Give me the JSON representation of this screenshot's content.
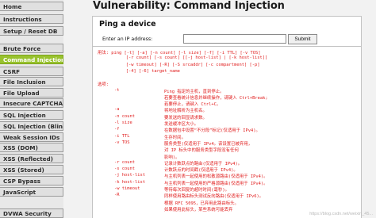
{
  "sidebar": {
    "items": [
      {
        "label": "Home",
        "active": false
      },
      {
        "label": "Instructions",
        "active": false
      },
      {
        "label": "Setup / Reset DB",
        "active": false
      },
      {
        "label": "Brute Force",
        "active": false
      },
      {
        "label": "Command Injection",
        "active": true
      },
      {
        "label": "CSRF",
        "active": false
      },
      {
        "label": "File Inclusion",
        "active": false
      },
      {
        "label": "File Upload",
        "active": false
      },
      {
        "label": "Insecure CAPTCHA",
        "active": false
      },
      {
        "label": "SQL Injection",
        "active": false
      },
      {
        "label": "SQL Injection (Blind)",
        "active": false
      },
      {
        "label": "Weak Session IDs",
        "active": false
      },
      {
        "label": "XSS (DOM)",
        "active": false
      },
      {
        "label": "XSS (Reflected)",
        "active": false
      },
      {
        "label": "XSS (Stored)",
        "active": false
      },
      {
        "label": "CSP Bypass",
        "active": false
      },
      {
        "label": "JavaScript",
        "active": false
      },
      {
        "label": "DVWA Security",
        "active": false
      }
    ],
    "accent_color": "#98c22e"
  },
  "main": {
    "title": "Vulnerability: Command Injection",
    "box_title": "Ping a device",
    "ip_label": "Enter an IP address:",
    "ip_value": "",
    "submit_label": "Submit"
  },
  "output": {
    "usage_lines": [
      "用法: ping [-t] [-a] [-n count] [-l size] [-f] [-i TTL] [-v TOS]",
      "           [-r count] [-s count] [[-j host-list] | [-k host-list]]",
      "           [-w timeout] [-R] [-S srcaddr] [-c compartment] [-p]",
      "           [-4] [-6] target_name"
    ],
    "options_heading": "选项:",
    "options": [
      {
        "flag": "-t",
        "text": "Ping 指定的主机，直到停止。"
      },
      {
        "flag": "",
        "text": "若要查看统计信息并继续操作，请键入 Ctrl+Break;"
      },
      {
        "flag": "",
        "text": "若要停止，请键入 Ctrl+C。"
      },
      {
        "flag": "-a",
        "text": "将地址解析为主机名。"
      },
      {
        "flag": "-n count",
        "text": "要发送的回显请求数。"
      },
      {
        "flag": "-l size",
        "text": "发送缓冲区大小。"
      },
      {
        "flag": "-f",
        "text": "在数据包中设置“不分段”标记(仅适用于 IPv4)。"
      },
      {
        "flag": "-i TTL",
        "text": "生存时间。"
      },
      {
        "flag": "-v TOS",
        "text": "服务类型(仅适用于 IPv4。该设置已被弃用，"
      },
      {
        "flag": "",
        "text": "对 IP 标头中的服务类型字段没有任何"
      },
      {
        "flag": "",
        "text": "影响)。"
      },
      {
        "flag": "-r count",
        "text": "记录计数跃点的路由(仅适用于 IPv4)。"
      },
      {
        "flag": "-s count",
        "text": "计数跃点的时间戳(仅适用于 IPv4)。"
      },
      {
        "flag": "-j host-list",
        "text": "与主机列表一起使用的松散源路由(仅适用于 IPv4)。"
      },
      {
        "flag": "-k host-list",
        "text": "与主机列表一起使用的严格源路由(仅适用于 IPv4)。"
      },
      {
        "flag": "-w timeout",
        "text": "等待每次回复的超时时间(毫秒)。"
      },
      {
        "flag": "-R",
        "text": "同样使用路由标头测试反向路由(仅适用于 IPv6)。"
      },
      {
        "flag": "",
        "text": "根据 RFC 5095，已弃用此路由标头。"
      },
      {
        "flag": "",
        "text": "如果使用此标头，某些系统可能丢弃"
      }
    ]
  },
  "footer": {
    "watermark": "https://blog.csdn.net/weixin_45..."
  }
}
